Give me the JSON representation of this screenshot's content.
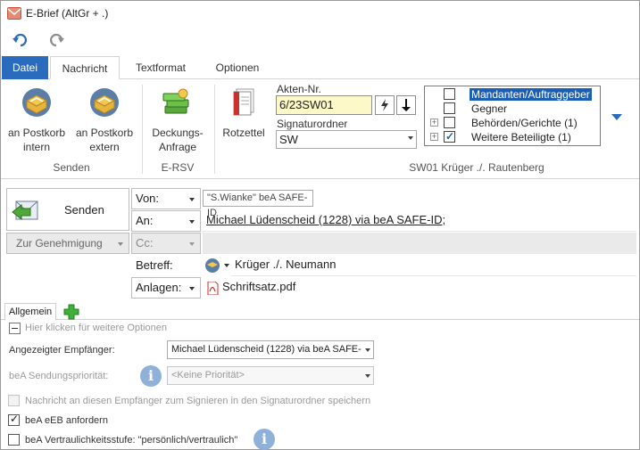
{
  "window": {
    "title": "E-Brief (AltGr + .)"
  },
  "tabs": [
    {
      "label": "Datei"
    },
    {
      "label": "Nachricht"
    },
    {
      "label": "Textformat"
    },
    {
      "label": "Optionen"
    }
  ],
  "ribbon": {
    "buttons": {
      "postkorb_intern": "an Postkorb\nintern",
      "postkorb_extern": "an Postkorb\nextern",
      "deckungs": "Deckungs-\nAnfrage",
      "rotzettel": "Rotzettel"
    },
    "groups": {
      "senden": "Senden",
      "ersv": "E-RSV",
      "case": "SW01 Krüger ./. Rautenberg"
    },
    "akten_label": "Akten-Nr.",
    "akten_value": "6/23SW01",
    "signatur_label": "Signaturordner",
    "signatur_value": "SW",
    "tree": [
      {
        "label": "Mandanten/Auftraggeber",
        "checked": false,
        "expandable": false,
        "selected": true
      },
      {
        "label": "Gegner",
        "checked": false,
        "expandable": false,
        "selected": false
      },
      {
        "label": "Behörden/Gerichte (1)",
        "checked": false,
        "expandable": true,
        "selected": false
      },
      {
        "label": "Weitere Beteiligte (1)",
        "checked": true,
        "expandable": true,
        "selected": false
      }
    ]
  },
  "header": {
    "senden": "Senden",
    "genehmigung": "Zur Genehmigung",
    "von_label": "Von:",
    "von_value": "\"S.Wianke\" beA SAFE-ID",
    "an_label": "An:",
    "an_value": "Michael Lüdenscheid (1228) via beA SAFE-ID;",
    "cc_label": "Cc:",
    "betreff_label": "Betreff:",
    "betreff_value": "Krüger ./. Neumann",
    "anlagen_label": "Anlagen:",
    "anlagen_value": "Schriftsatz.pdf"
  },
  "options": {
    "tab_label": "Allgemein",
    "more_options": "Hier klicken für weitere Optionen",
    "empfaenger_label": "Angezeigter Empfänger:",
    "empfaenger_value": "Michael Lüdenscheid (1228) via beA SAFE-",
    "prioritaet_label": "beA Sendungspriorität:",
    "prioritaet_value": "<Keine Priorität>",
    "signieren_label": "Nachricht an diesen Empfänger zum Signieren in den Signaturordner speichern",
    "eeb_label": "beA eEB anfordern",
    "vertraulich_label": "beA Vertraulichkeitsstufe: \"persönlich/vertraulich\""
  }
}
